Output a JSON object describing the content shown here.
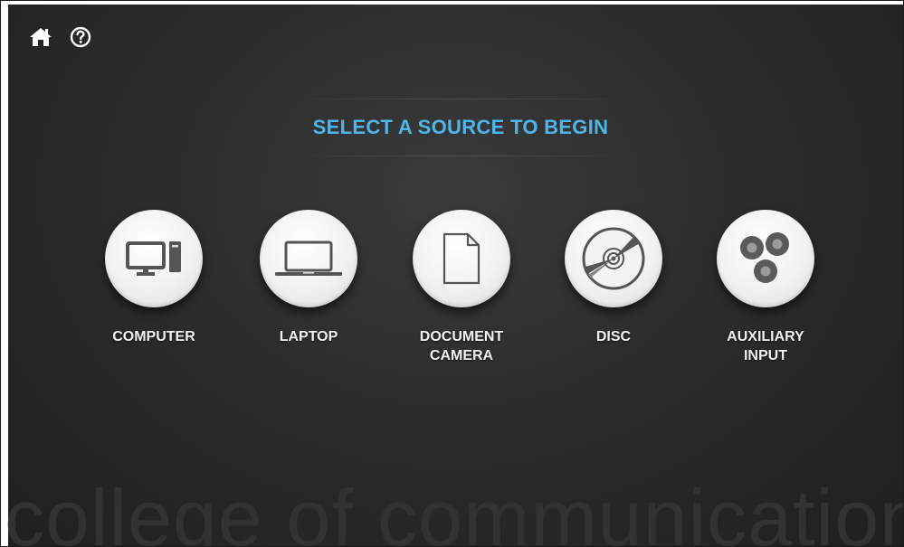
{
  "topbar": {
    "home_icon": "home-icon",
    "help_icon": "help-icon"
  },
  "title": "SELECT A SOURCE TO BEGIN",
  "sources": [
    {
      "label_line1": "COMPUTER",
      "label_line2": "",
      "icon": "computer-icon"
    },
    {
      "label_line1": "LAPTOP",
      "label_line2": "",
      "icon": "laptop-icon"
    },
    {
      "label_line1": "DOCUMENT",
      "label_line2": "CAMERA",
      "icon": "document-camera-icon"
    },
    {
      "label_line1": "DISC",
      "label_line2": "",
      "icon": "disc-icon"
    },
    {
      "label_line1": "AUXILIARY",
      "label_line2": "INPUT",
      "icon": "auxiliary-input-icon"
    }
  ],
  "watermark": "college of communication",
  "colors": {
    "title": "#4eb6ea",
    "background": "#2c2c2c",
    "icon_circle": "#f1f1f1",
    "icon_glyph": "#555555"
  }
}
